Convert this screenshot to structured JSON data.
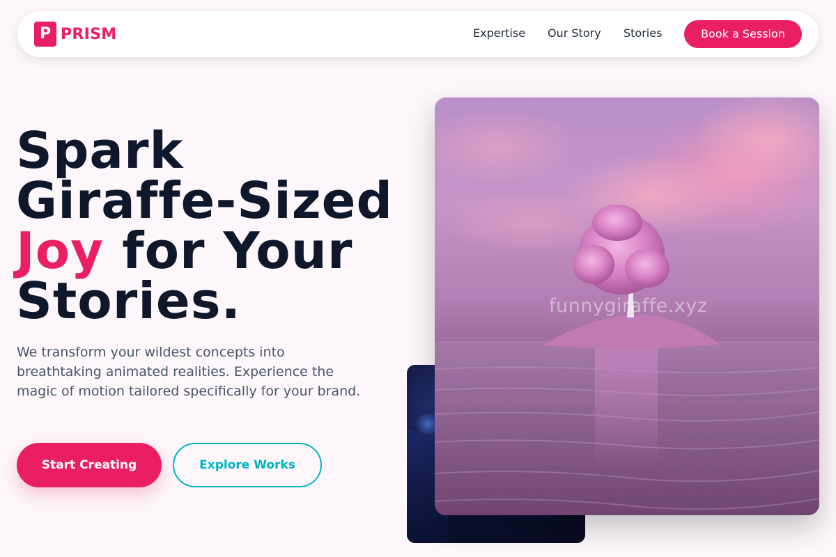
{
  "brand": {
    "mark": "P",
    "name": "PRISM",
    "color": "#e91e63"
  },
  "nav": {
    "links": [
      "Expertise",
      "Our Story",
      "Stories"
    ],
    "cta": "Book a Session"
  },
  "hero": {
    "headline_line1": "Spark",
    "headline_line2": "Giraffe-Sized",
    "headline_accent": "Joy",
    "headline_line3_rest": " for Your",
    "headline_line4": "Stories.",
    "subtext": "We transform your wildest concepts into breathtaking animated realities. Experience the magic of motion tailored specifically for your brand.",
    "primary_button": "Start Creating",
    "secondary_button": "Explore Works"
  },
  "images": {
    "main_watermark": "funnygiraffe.xyz"
  },
  "colors": {
    "accent": "#e91e63",
    "secondary": "#00b4c6",
    "heading": "#0f172a",
    "body_text": "#475569",
    "background": "#fdf7fb"
  }
}
